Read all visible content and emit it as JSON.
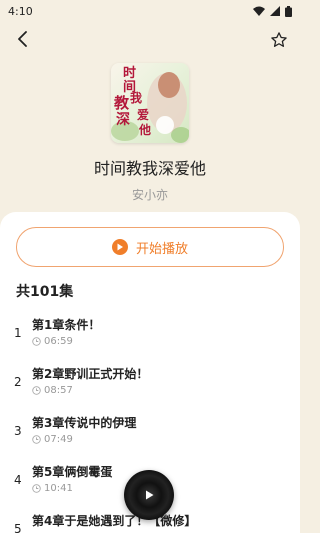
{
  "status_bar": {
    "time": "4:10"
  },
  "book": {
    "title": "时间教我深爱他",
    "author": "安小亦",
    "cover_text": [
      "时",
      "间",
      "教",
      "我",
      "深",
      "爱",
      "他"
    ]
  },
  "play_all_label": "开始播放",
  "episode_count": "共101集",
  "episodes": [
    {
      "index": "1",
      "title": "第1章条件！",
      "duration": "06:59"
    },
    {
      "index": "2",
      "title": "第2章野训正式开始！",
      "duration": "08:57"
    },
    {
      "index": "3",
      "title": "第3章传说中的伊理",
      "duration": "07:49"
    },
    {
      "index": "4",
      "title": "第5章俩倒霉蛋",
      "duration": "10:41"
    },
    {
      "index": "5",
      "title": "第4章于是她遇到了！【微修】",
      "duration": ""
    }
  ],
  "colors": {
    "accent": "#f07e2a",
    "background": "#f5efe2"
  },
  "icons": {
    "back": "chevron-left-icon",
    "favorite": "star-outline-icon",
    "play": "play-icon",
    "clock": "clock-icon"
  }
}
